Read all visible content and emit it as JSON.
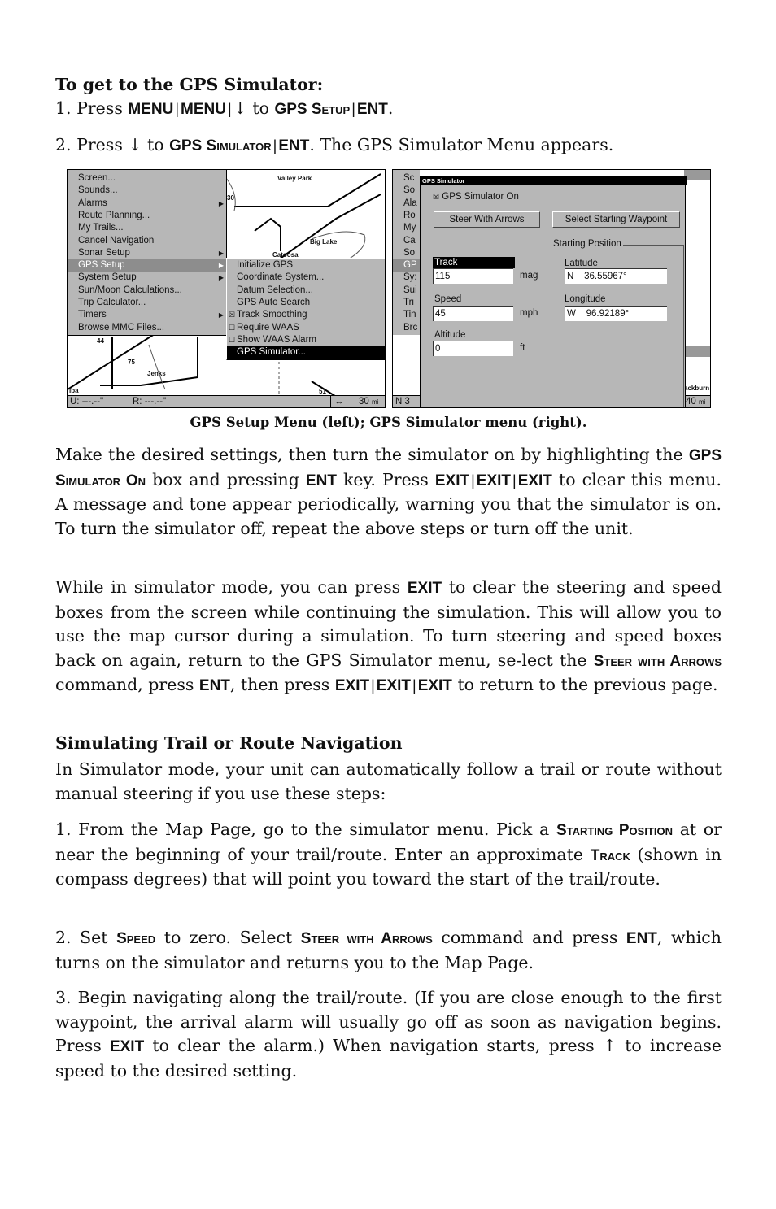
{
  "intro": {
    "heading": "To get to the GPS Simulator:",
    "step1": [
      {
        "t": "1. Press "
      },
      {
        "k": "MENU"
      },
      {
        "s": "|"
      },
      {
        "k": "MENU"
      },
      {
        "s": "|"
      },
      {
        "t": "↓ to "
      },
      {
        "k": "GPS Setup"
      },
      {
        "s": "|"
      },
      {
        "k": "ENT"
      },
      {
        "t": "."
      }
    ],
    "step2": [
      {
        "t": "2. Press ↓ to "
      },
      {
        "k": "GPS Simulator"
      },
      {
        "s": "|"
      },
      {
        "k": "ENT"
      },
      {
        "t": ". The GPS Simulator Menu appears."
      }
    ]
  },
  "figure": {
    "left": {
      "menu_items": [
        {
          "label": "Screen..."
        },
        {
          "label": "Sounds..."
        },
        {
          "label": "Alarms",
          "submenu": true
        },
        {
          "label": "Route Planning..."
        },
        {
          "label": "My Trails..."
        },
        {
          "label": "Cancel Navigation"
        },
        {
          "label": "Sonar Setup",
          "submenu": true
        },
        {
          "label": "GPS Setup",
          "submenu": true,
          "selected": true
        },
        {
          "label": "System Setup",
          "submenu": true
        },
        {
          "label": "Sun/Moon Calculations..."
        },
        {
          "label": "Trip Calculator..."
        },
        {
          "label": "Timers",
          "submenu": true
        },
        {
          "label": "Browse MMC Files..."
        }
      ],
      "submenu_items": [
        {
          "label": "Initialize GPS"
        },
        {
          "label": "Coordinate System..."
        },
        {
          "label": "Datum Selection..."
        },
        {
          "label": "GPS Auto Search"
        },
        {
          "label": "Track Smoothing",
          "checkbox": true,
          "checked": true
        },
        {
          "label": "Require WAAS",
          "checkbox": true,
          "checked": false
        },
        {
          "label": "Show WAAS Alarm",
          "checkbox": true,
          "checked": false
        },
        {
          "label": "GPS Simulator...",
          "selected": true
        }
      ],
      "map_labels": {
        "valley_park": "Valley Park",
        "big_lake": "Big Lake",
        "catoosa": "Catoosa",
        "jenks": "Jenks",
        "hwy44": "44",
        "hwy75": "75",
        "hwy51": "51",
        "partial_30": "30",
        "partial_iba": "iba"
      },
      "status": {
        "u": "U:  ---.--\"",
        "r": "R:  ---.--\"",
        "pan": "↔",
        "zoom": "30",
        "zoom_unit": "mi"
      }
    },
    "right": {
      "behind_menu": [
        "Sc",
        "So",
        "Ala",
        "Ro",
        "My",
        "Ca",
        "So",
        "GP",
        "Sy:",
        "Sui",
        "Tri",
        "Tin",
        "Brc"
      ],
      "behind_status": {
        "n": "N   3",
        "zoom": "40",
        "zoom_unit": "mi",
        "place": "ackburn"
      },
      "dialog": {
        "title": "GPS Simulator",
        "simulator_on": {
          "label": "GPS Simulator On",
          "checked": true
        },
        "steer_button": "Steer With Arrows",
        "waypoint_button": "Select Starting Waypoint",
        "starting_position": "Starting Position",
        "track": {
          "label": "Track",
          "value": "115",
          "unit": "mag"
        },
        "speed": {
          "label": "Speed",
          "value": "45",
          "unit": "mph"
        },
        "altitude": {
          "label": "Altitude",
          "value": "0",
          "unit": "ft"
        },
        "latitude": {
          "label": "Latitude",
          "value": "N    36.55967°"
        },
        "longitude": {
          "label": "Longitude",
          "value": "W    96.92189°"
        }
      }
    },
    "caption": "GPS Setup Menu (left); GPS Simulator menu (right)."
  },
  "body": {
    "p1": [
      {
        "t": "Make the desired settings, then turn the simulator on by highlighting the "
      },
      {
        "k": "GPS Simulator On"
      },
      {
        "t": " box and pressing "
      },
      {
        "k": "ENT"
      },
      {
        "t": " key. Press "
      },
      {
        "k": "EXIT"
      },
      {
        "s": "|"
      },
      {
        "k": "EXIT"
      },
      {
        "s": "|"
      },
      {
        "k": "EXIT"
      },
      {
        "t": " to clear this menu. A message and tone appear periodically, warning you that the simulator is on. To turn the simulator off, repeat the above steps or turn off the unit."
      }
    ],
    "p2": [
      {
        "t": "While in simulator mode, you can press "
      },
      {
        "k": "EXIT"
      },
      {
        "t": " to clear the steering and speed boxes from the screen while continuing the simulation. This will allow you to use the map cursor during a simulation. To turn steering and speed boxes back on again, return to the GPS Simulator menu, se-lect the "
      },
      {
        "k": "Steer with Arrows"
      },
      {
        "t": " command, press "
      },
      {
        "k": "ENT"
      },
      {
        "t": ", then press "
      },
      {
        "k": "EXIT"
      },
      {
        "s": "|"
      },
      {
        "k": "EXIT"
      },
      {
        "s": "|"
      },
      {
        "k": "EXIT"
      },
      {
        "t": " to return to the previous page."
      }
    ],
    "section_heading": "Simulating Trail or Route Navigation",
    "p3": [
      {
        "t": "In Simulator mode, your unit can automatically follow a trail or route without manual steering if you use these steps:"
      }
    ],
    "p4": [
      {
        "t": "1. From the Map Page, go to the simulator menu. Pick a "
      },
      {
        "k": "Starting Position"
      },
      {
        "t": " at or near the beginning of your trail/route. Enter an approximate "
      },
      {
        "k": "Track"
      },
      {
        "t": " (shown in compass degrees) that will point you toward the start of the trail/route."
      }
    ],
    "p5": [
      {
        "t": "2. Set "
      },
      {
        "k": "Speed"
      },
      {
        "t": " to zero. Select "
      },
      {
        "k": "Steer with Arrows"
      },
      {
        "t": " command and press "
      },
      {
        "k": "ENT"
      },
      {
        "t": ", which turns on the simulator and returns you to the Map Page."
      }
    ],
    "p6": [
      {
        "t": "3. Begin navigating along the trail/route. (If you are close enough to the first waypoint, the arrival alarm will usually go off as soon as navigation begins. Press "
      },
      {
        "k": "EXIT"
      },
      {
        "t": " to clear the alarm.) When navigation starts, press ↑ to increase speed to the desired setting."
      }
    ]
  }
}
